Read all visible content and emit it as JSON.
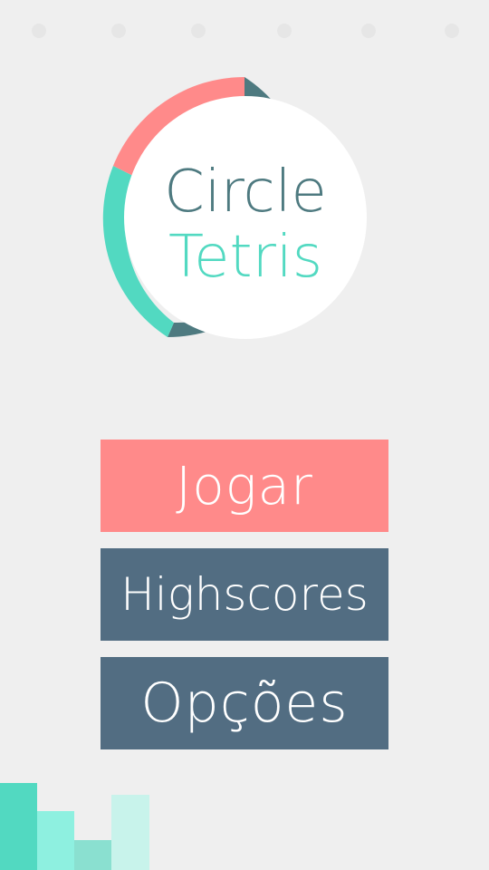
{
  "title": {
    "line1": "Circle",
    "line2": "Tetris"
  },
  "menu": {
    "play_label": "Jogar",
    "highscores_label": "Highscores",
    "options_label": "Opções"
  },
  "colors": {
    "background": "#efefef",
    "coral": "#ff8a8a",
    "slate": "#526d82",
    "teal_dark": "#4e7a80",
    "mint": "#52d9c1",
    "mint_light": "#8ef0e0",
    "mint_mid": "#8ae0d0",
    "mint_pale": "#c8f3eb"
  },
  "icons": {
    "logo": "circle-tetris-ring-logo",
    "dots": "progress-dots"
  }
}
